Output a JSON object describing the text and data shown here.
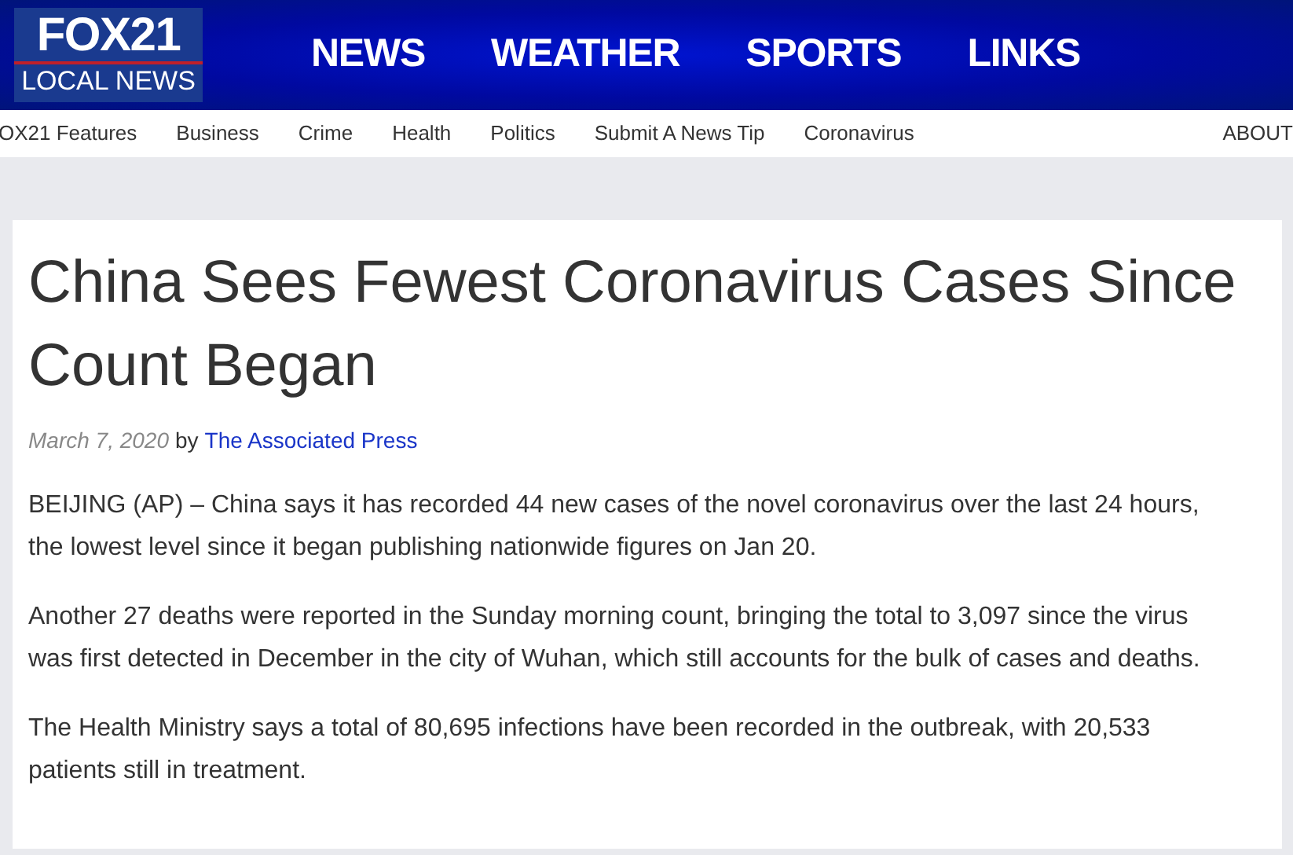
{
  "logo": {
    "top": "FOX21",
    "bottom": "LOCAL NEWS"
  },
  "main_nav": [
    "NEWS",
    "WEATHER",
    "SPORTS",
    "LINKS"
  ],
  "sub_nav": {
    "items": [
      "OX21 Features",
      "Business",
      "Crime",
      "Health",
      "Politics",
      "Submit A News Tip",
      "Coronavirus"
    ],
    "right": "ABOUT"
  },
  "article": {
    "title": "China Sees Fewest Coronavirus Cases Since Count Began",
    "date": "March 7, 2020",
    "by": "by",
    "author": "The Associated Press",
    "paragraphs": [
      "BEIJING (AP) – China says it has recorded 44 new cases of the novel coronavirus over the last 24 hours, the lowest level since it began publishing nationwide figures on Jan 20.",
      "Another 27 deaths were reported in the Sunday morning count, bringing the total to 3,097 since the virus was first detected in December in the city of Wuhan, which still accounts for the bulk of cases and deaths.",
      "The Health Ministry says a total of 80,695 infections have been recorded in the outbreak, with 20,533 patients still in treatment."
    ]
  }
}
